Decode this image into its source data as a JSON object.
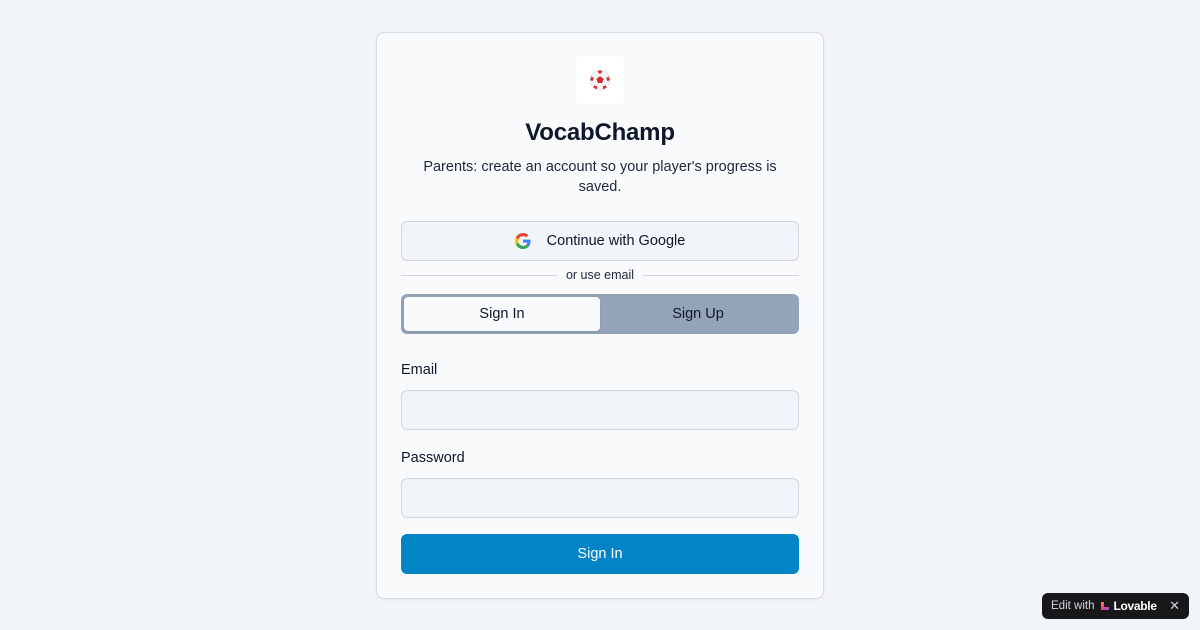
{
  "app": {
    "logo_icon": "soccer-ball-icon",
    "title": "VocabChamp",
    "subtitle": "Parents: create an account so your player's progress is saved."
  },
  "auth": {
    "google_label": "Continue with Google",
    "divider_text": "or use email",
    "tabs": [
      {
        "label": "Sign In",
        "active": true
      },
      {
        "label": "Sign Up",
        "active": false
      }
    ],
    "email_label": "Email",
    "email_value": "",
    "password_label": "Password",
    "password_value": "",
    "submit_label": "Sign In"
  },
  "badge": {
    "edit_text": "Edit with",
    "brand": "Lovable",
    "close_icon": "close-icon"
  },
  "colors": {
    "background": "#f1f4f8",
    "primary": "#0284c7",
    "tab_track": "#94a3b8"
  }
}
